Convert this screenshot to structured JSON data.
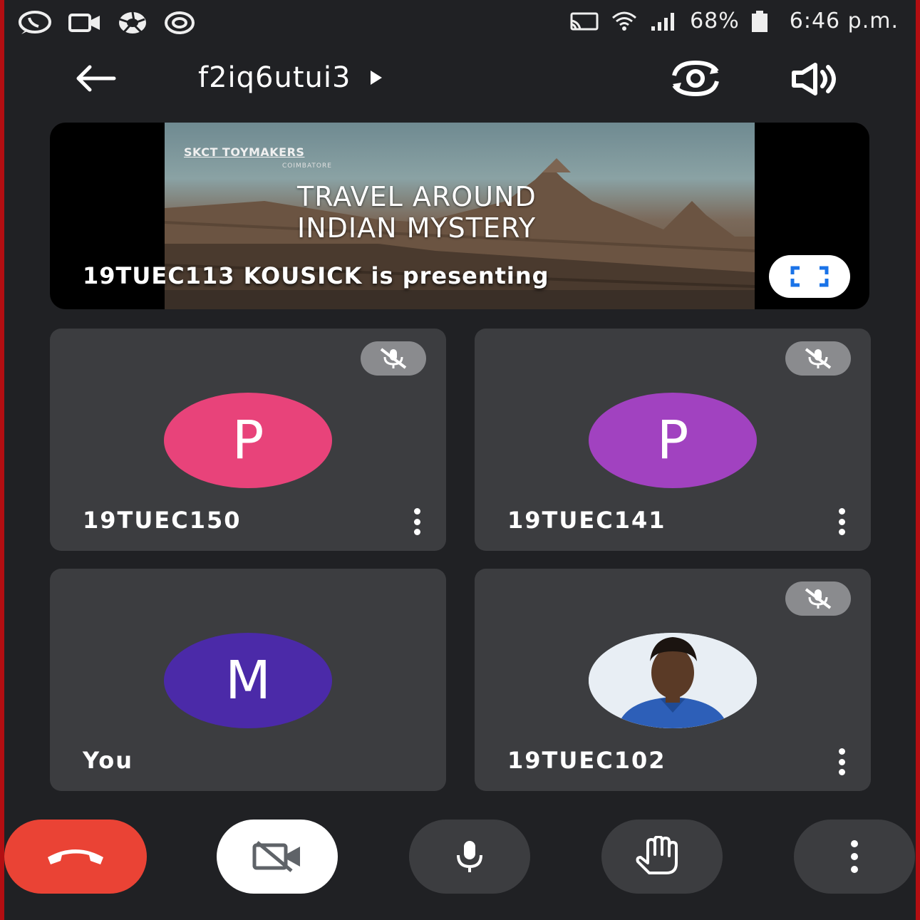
{
  "status_bar": {
    "battery": "68%",
    "time": "6:46 p.m.",
    "icons_left": [
      "whatsapp-icon",
      "video-call-icon",
      "aperture-icon",
      "camera-lens-icon"
    ],
    "icons_right": [
      "cast-icon",
      "wifi-icon",
      "signal-icon",
      "battery-icon"
    ]
  },
  "app_bar": {
    "meeting_code": "f2iq6utui3",
    "icons": [
      "back-arrow-icon",
      "play-triangle-icon",
      "switch-camera-icon",
      "speaker-icon"
    ]
  },
  "presentation": {
    "slide_brand": "SKCT TOYMAKERS",
    "slide_city": "COIMBATORE",
    "slide_title_line1": "TRAVEL AROUND",
    "slide_title_line2": "INDIAN MYSTERY",
    "presenting_text": "19TUEC113 KOUSICK is presenting",
    "fullscreen_icon": "fullscreen-icon"
  },
  "participants": [
    {
      "name": "19TUEC150",
      "initial": "P",
      "color": "#e8437a",
      "muted": true
    },
    {
      "name": "19TUEC141",
      "initial": "P",
      "color": "#a142c0",
      "muted": true
    },
    {
      "name": "You",
      "initial": "M",
      "color": "#4b2aa8",
      "muted": false
    },
    {
      "name": "19TUEC102",
      "initial": "",
      "color": "#dfe6ee",
      "muted": true,
      "photo": true
    }
  ],
  "controls": {
    "end_call_color": "#ea4335",
    "icons": [
      "end-call-icon",
      "camera-off-icon",
      "microphone-icon",
      "raise-hand-icon",
      "more-options-icon"
    ]
  }
}
